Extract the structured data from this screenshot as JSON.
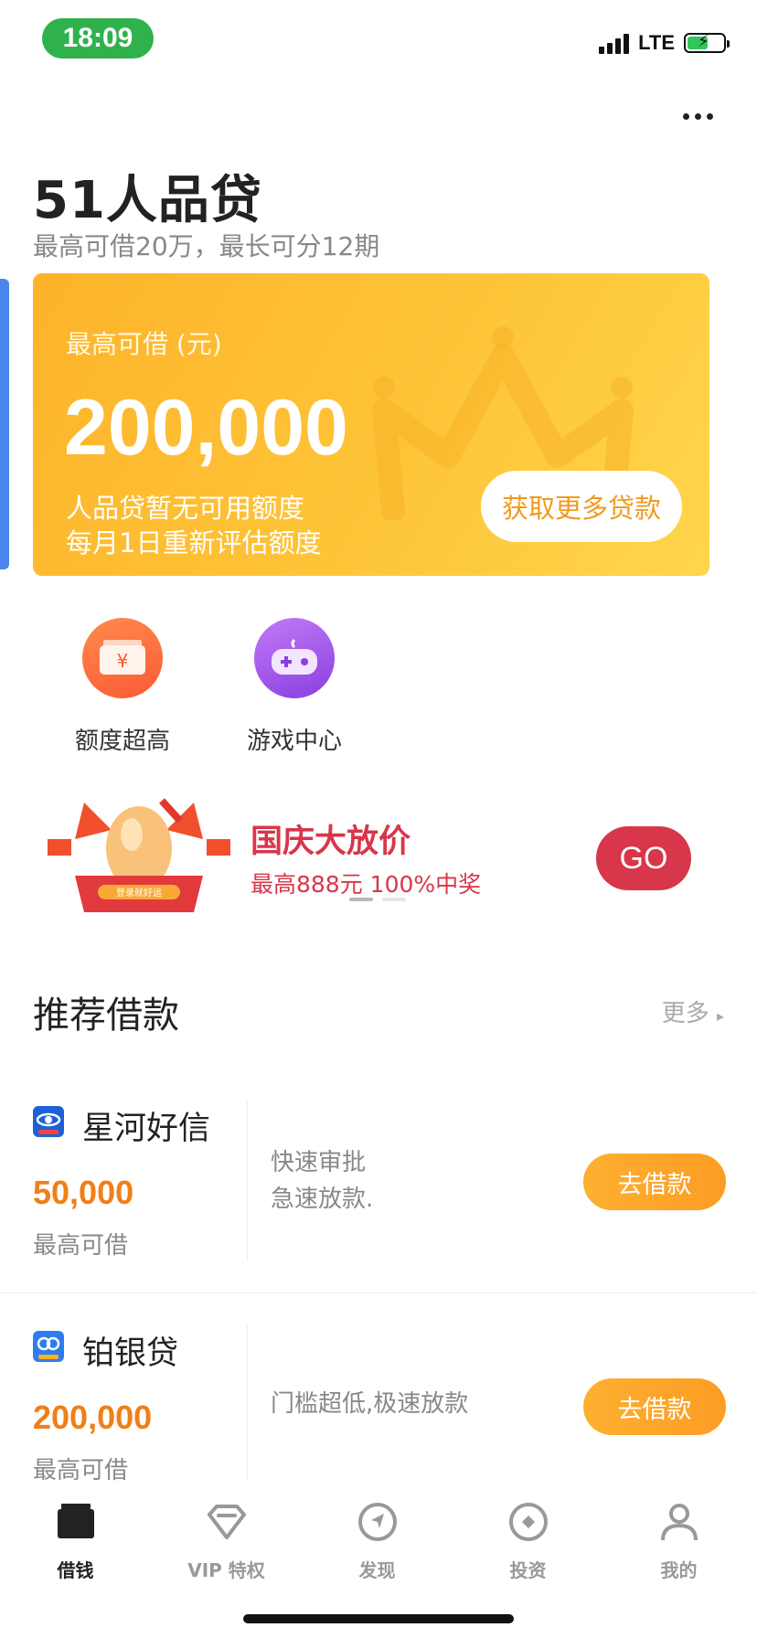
{
  "status_bar": {
    "time": "18:09",
    "network": "LTE"
  },
  "header": {
    "title": "51人品贷",
    "subtitle": "最高可借20万，最长可分12期"
  },
  "hero": {
    "label": "最高可借 (元)",
    "amount": "200,000",
    "note_line1": "人品贷暂无可用额度",
    "note_line2": "每月1日重新评估额度",
    "button": "获取更多贷款"
  },
  "features": [
    {
      "label": "额度超高",
      "icon": "wallet-yen-icon",
      "color": "#fd6a3a"
    },
    {
      "label": "游戏中心",
      "icon": "gamepad-icon",
      "color": "#a456e6"
    }
  ],
  "banner": {
    "title": "国庆大放价",
    "subtitle": "最高888元 100%中奖",
    "go": "GO",
    "prize_label": "登录就好运"
  },
  "recommend": {
    "title": "推荐借款",
    "more": "更多"
  },
  "loans": [
    {
      "name": "星河好信",
      "amount": "50,000",
      "caption": "最高可借",
      "desc_line1": "快速审批",
      "desc_line2": "急速放款.",
      "button": "去借款",
      "logo_color": "#1f5fd8"
    },
    {
      "name": "铂银贷",
      "amount": "200,000",
      "caption": "最高可借",
      "desc_line1": "门槛超低,极速放款",
      "desc_line2": "",
      "button": "去借款",
      "logo_color": "#2d7df0"
    }
  ],
  "tabs": [
    {
      "label": "借钱",
      "icon": "wallet-icon",
      "active": true
    },
    {
      "label": "VIP 特权",
      "icon": "diamond-icon",
      "active": false
    },
    {
      "label": "发现",
      "icon": "compass-icon",
      "active": false
    },
    {
      "label": "投资",
      "icon": "coin-icon",
      "active": false
    },
    {
      "label": "我的",
      "icon": "user-icon",
      "active": false
    }
  ],
  "colors": {
    "accent_orange": "#fdb32a",
    "amount_orange": "#f07f17",
    "banner_red": "#d8364a",
    "tab_active": "#222222",
    "tab_inactive": "#999999"
  }
}
